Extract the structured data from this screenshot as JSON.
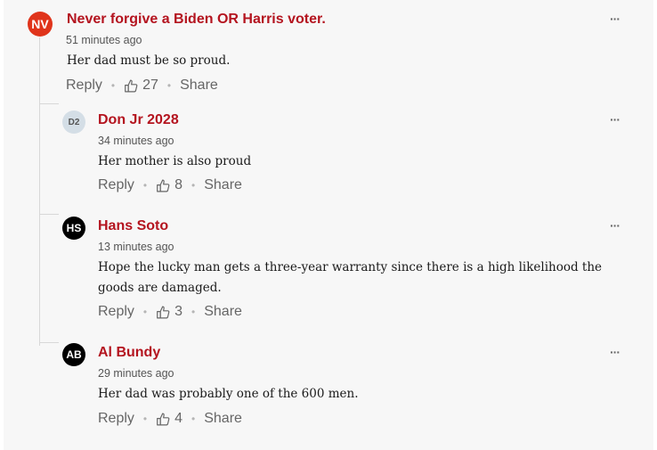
{
  "comments": [
    {
      "initials": "NV",
      "avatar_bg": "#e0341b",
      "avatar_fg": "#ffffff",
      "author": "Never forgive a Biden OR Harris voter.",
      "time": "51 minutes ago",
      "text": "Her dad must be so proud.",
      "reply": "Reply",
      "likes": "27",
      "share": "Share",
      "more": "···",
      "like_icon": "thumbs-up-icon"
    },
    {
      "initials": "D2",
      "avatar_bg": "#d4dee6",
      "avatar_fg": "#555555",
      "author": "Don Jr 2028",
      "time": "34 minutes ago",
      "text": "Her mother is also proud",
      "reply": "Reply",
      "likes": "8",
      "share": "Share",
      "more": "···",
      "like_icon": "thumbs-up-icon"
    },
    {
      "initials": "HS",
      "avatar_bg": "#000000",
      "avatar_fg": "#ffffff",
      "author": "Hans Soto",
      "time": "13 minutes ago",
      "text": "Hope the lucky man gets a three-year warranty since there is a high likelihood the goods are damaged.",
      "reply": "Reply",
      "likes": "3",
      "share": "Share",
      "more": "···",
      "like_icon": "thumbs-up-icon"
    },
    {
      "initials": "AB",
      "avatar_bg": "#000000",
      "avatar_fg": "#ffffff",
      "author": "Al Bundy",
      "time": "29 minutes ago",
      "text": "Her dad was probably one of the 600 men.",
      "reply": "Reply",
      "likes": "4",
      "share": "Share",
      "more": "···",
      "like_icon": "thumbs-up-icon"
    }
  ],
  "dot": "•"
}
